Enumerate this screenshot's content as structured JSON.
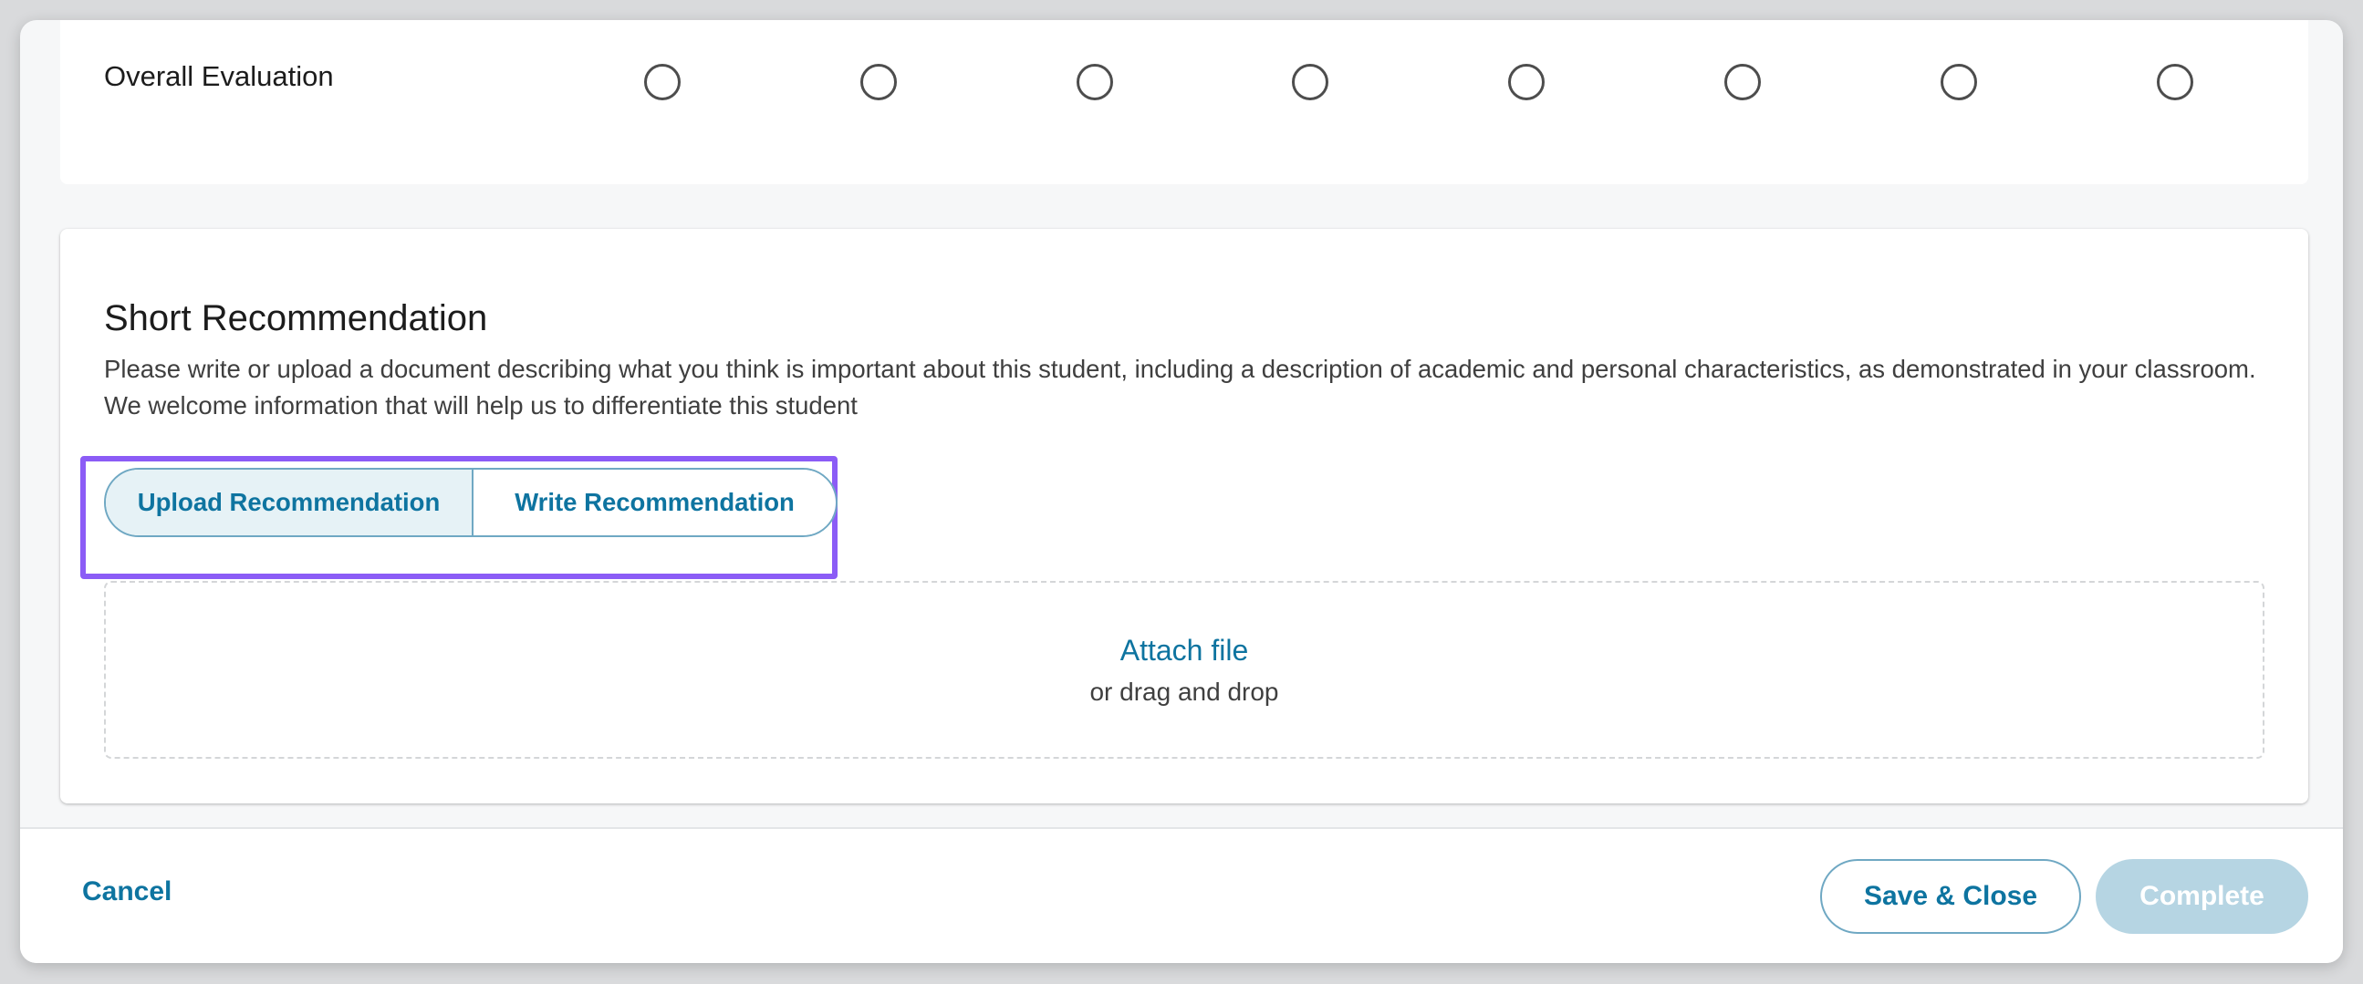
{
  "evaluation": {
    "label": "Overall Evaluation",
    "options": [
      "",
      "",
      "",
      "",
      "",
      "",
      "",
      ""
    ]
  },
  "recommendation": {
    "title": "Short Recommendation",
    "description": "Please write or upload a document describing what you think is important about this student, including a description of academic and personal characteristics, as demonstrated in your classroom. We welcome information that will help us to differentiate this student",
    "toggle": {
      "upload_label": "Upload Recommendation",
      "write_label": "Write Recommendation",
      "selected": "Upload Recommendation"
    },
    "dropzone": {
      "attach_label": "Attach file",
      "drag_label": "or drag and drop"
    }
  },
  "footer": {
    "cancel_label": "Cancel",
    "save_label": "Save & Close",
    "complete_label": "Complete"
  },
  "colors": {
    "accent": "#0e74a0",
    "highlight": "#8b5cf6",
    "disabled_button": "#b6d5e3"
  }
}
